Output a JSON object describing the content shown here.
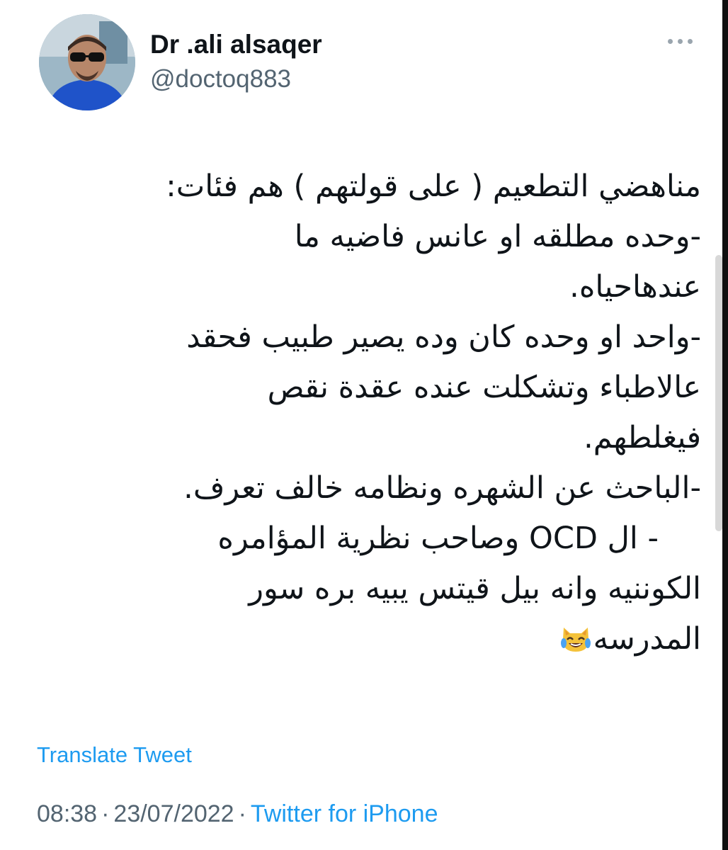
{
  "tweet": {
    "author": {
      "display_name": "Dr .ali alsaqer",
      "handle": "@doctoq883"
    },
    "more_icon": "more-horizontal-icon",
    "lines": [
      "مناهضي التطعيم ( على قولتهم ) هم فئات:",
      "-وحده مطلقه او عانس فاضيه ما",
      "عندهاحياه.",
      "-واحد او وحده كان وده يصير طبيب فحقد",
      "عالاطباء وتشكلت عنده عقدة نقص",
      "فيغلطهم.",
      "-الباحث عن الشهره ونظامه خالف تعرف.",
      "- ال OCD وصاحب نظرية المؤامره",
      "الكوننيه وانه بيل قيتس يبيه بره سور",
      "المدرسه"
    ],
    "emoji": "cat-face-with-tears-of-joy-icon",
    "translate_label": "Translate Tweet",
    "time": "08:38",
    "date": "23/07/2022",
    "source": "Twitter for iPhone",
    "separator": "·"
  }
}
